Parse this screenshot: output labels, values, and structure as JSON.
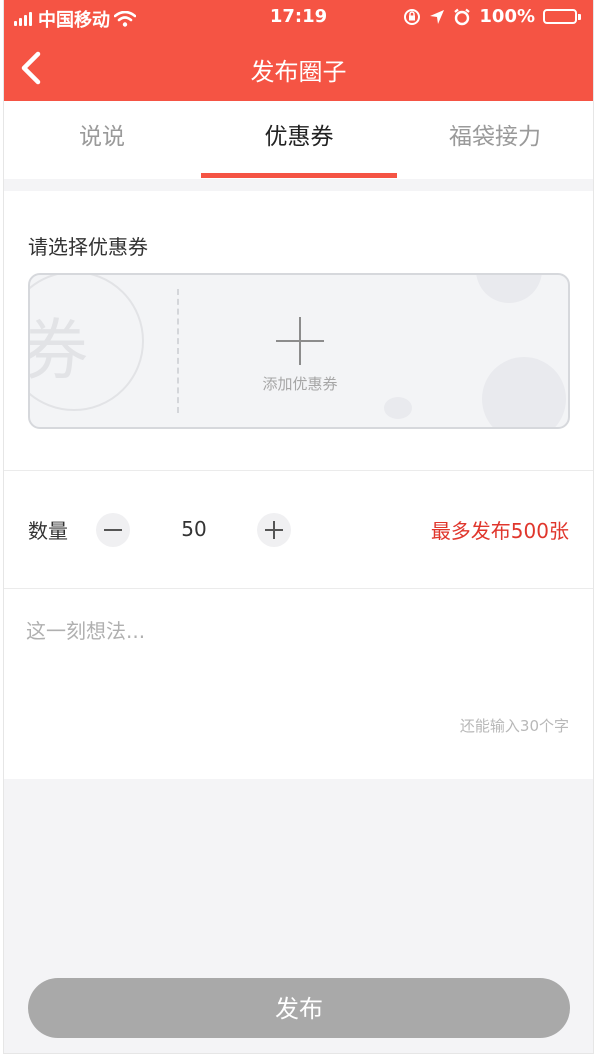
{
  "status_bar": {
    "carrier": "中国移动",
    "time": "17:19",
    "battery": "100%",
    "battery_level": 1.0
  },
  "nav": {
    "title": "发布圈子",
    "back_icon": "chevron-left-icon"
  },
  "tabs": [
    {
      "label": "说说",
      "active": false
    },
    {
      "label": "优惠券",
      "active": true
    },
    {
      "label": "福袋接力",
      "active": false
    }
  ],
  "coupon": {
    "label": "请选择优惠券",
    "stamp_text": "券",
    "add_label": "添加优惠券"
  },
  "quantity": {
    "label": "数量",
    "value": "50",
    "max_text": "最多发布500张"
  },
  "thought": {
    "placeholder": "这一刻想法...",
    "value": "",
    "counter": "还能输入30个字"
  },
  "publish": {
    "label": "发布"
  },
  "colors": {
    "brand": "#f55444",
    "max_text": "#e0362c",
    "button_disabled": "#a9a9a9"
  }
}
